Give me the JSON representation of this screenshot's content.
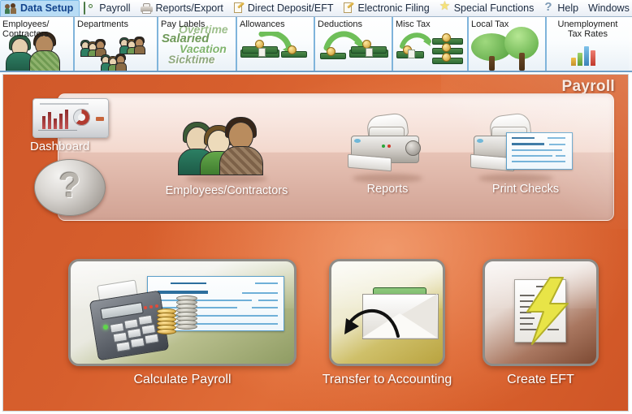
{
  "app": {
    "window_title": "Payroll",
    "accent_orange": "#d75f2d",
    "tabstrip_border": "#6f9ec6",
    "active_menu_bg": "#b8dcf5"
  },
  "menubar": {
    "items": [
      {
        "label": "Data Setup",
        "icon": "people-icon",
        "active": true
      },
      {
        "label": "Payroll",
        "icon": "money-icon",
        "active": false
      },
      {
        "label": "Reports/Export",
        "icon": "printer-icon",
        "active": false
      },
      {
        "label": "Direct Deposit/EFT",
        "icon": "document-pen-icon",
        "active": false
      },
      {
        "label": "Electronic Filing",
        "icon": "document-pen-icon",
        "active": false
      },
      {
        "label": "Special Functions",
        "icon": "star-icon",
        "active": false
      },
      {
        "label": "Help",
        "icon": "question-mark-icon",
        "active": false
      },
      {
        "label": "Windows",
        "icon": "none",
        "active": false
      }
    ]
  },
  "tabstrip": {
    "tabs": [
      {
        "label": "Employees/\nContractors",
        "icon": "two-people-icon"
      },
      {
        "label": "Departments",
        "icon": "people-groups-icon"
      },
      {
        "label": "Pay Labels",
        "icon": "pay-words-icon",
        "words": [
          "Overtime",
          "Salaried",
          "Vacation",
          "Sicktime"
        ]
      },
      {
        "label": "Allowances",
        "icon": "money-arrow-icon"
      },
      {
        "label": "Deductions",
        "icon": "money-arrow-icon"
      },
      {
        "label": "Misc Tax",
        "icon": "money-stacks-icon"
      },
      {
        "label": "Local Tax",
        "icon": "trees-icon"
      },
      {
        "label": "Unemployment\nTax Rates",
        "icon": "bar-chart-icon"
      }
    ]
  },
  "stage": {
    "title": "Payroll",
    "side": {
      "dashboard_label": "Dashboard",
      "dashboard_icon": "dashboard-chart-icon",
      "help_icon": "question-mark-icon"
    },
    "shelf_items": [
      {
        "label": "Employees/Contractors",
        "icon": "three-people-icon"
      },
      {
        "label": "Reports",
        "icon": "printer-icon"
      },
      {
        "label": "Print Checks",
        "icon": "printer-check-icon"
      }
    ],
    "cards": [
      {
        "label": "Calculate Payroll",
        "icon": "calculator-check-coins-icon"
      },
      {
        "label": "Transfer to Accounting",
        "icon": "envelope-money-arrow-icon"
      },
      {
        "label": "Create EFT",
        "icon": "document-lightning-icon"
      }
    ]
  }
}
